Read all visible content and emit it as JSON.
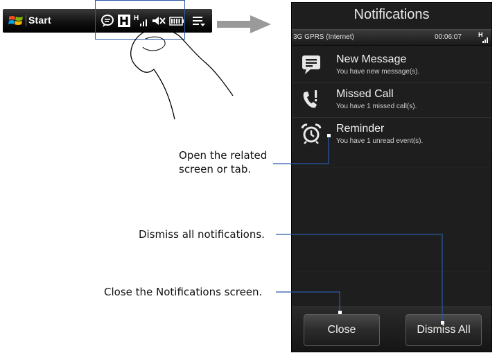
{
  "taskbar": {
    "start_label": "Start",
    "tray_icons": [
      "speech-bubble-icon",
      "h-network-icon",
      "h-signal-icon",
      "speaker-muted-icon",
      "battery-icon",
      "menu-icon"
    ]
  },
  "phone": {
    "title": "Notifications",
    "status": {
      "connection": "3G GPRS (Internet)",
      "time": "00:06:07"
    },
    "notifications": [
      {
        "title": "New Message",
        "subtitle": "You have new message(s).",
        "icon": "message-icon"
      },
      {
        "title": "Missed Call",
        "subtitle": "You have 1 missed call(s).",
        "icon": "missed-call-icon"
      },
      {
        "title": "Reminder",
        "subtitle": "You have 1 unread event(s).",
        "icon": "alarm-clock-icon"
      }
    ],
    "buttons": {
      "close_label": "Close",
      "dismiss_all_label": "Dismiss All"
    }
  },
  "callouts": {
    "open_related": [
      "Open the related",
      "screen or tab."
    ],
    "dismiss_all": "Dismiss all notifications.",
    "close_screen": "Close the Notifications screen."
  },
  "colors": {
    "callout_line": "#2a5aa8",
    "phone_bg": "#1e1e1e",
    "arrow": "#9a9a9a"
  }
}
